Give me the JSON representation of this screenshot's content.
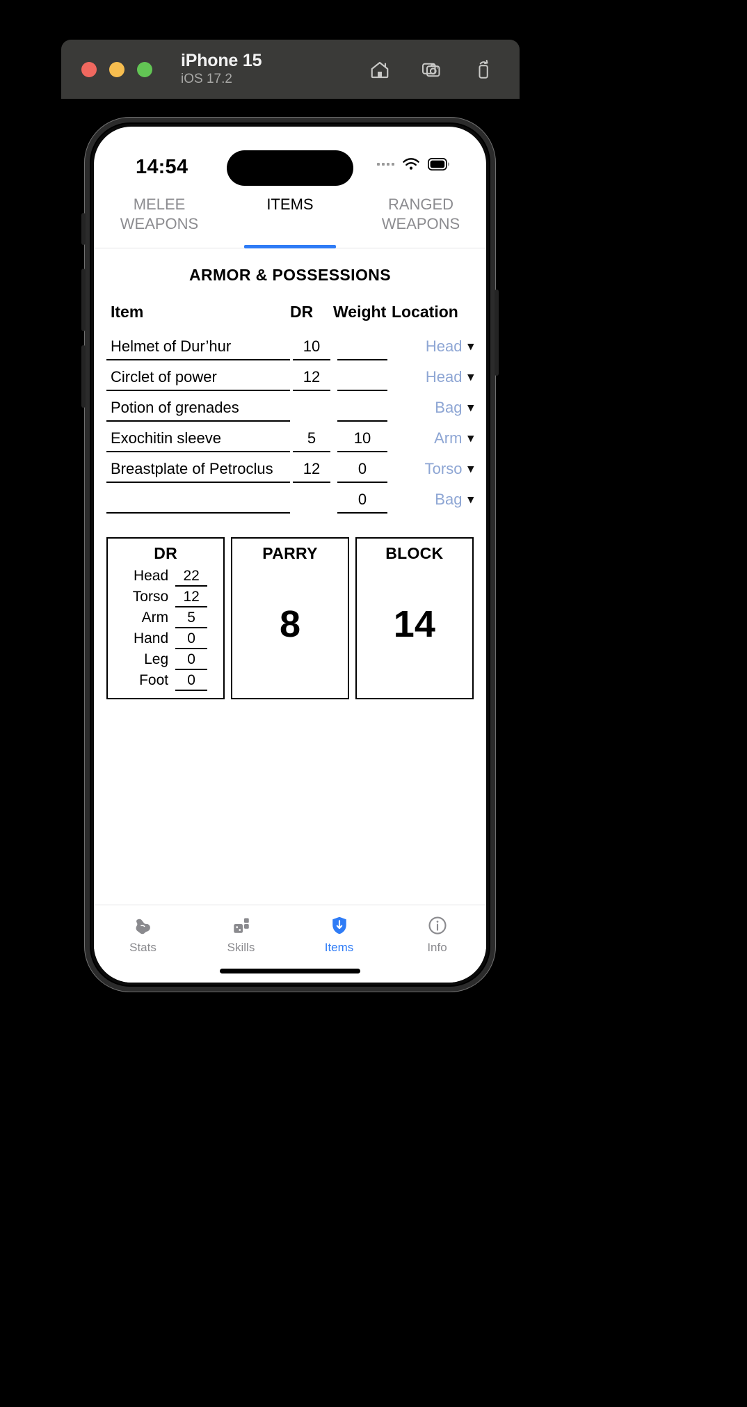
{
  "simulator": {
    "device_title": "iPhone 15",
    "os_version": "iOS 17.2",
    "window_controls": [
      "close",
      "minimize",
      "zoom"
    ],
    "actions": [
      {
        "name": "home-icon",
        "label": "Home"
      },
      {
        "name": "screenshot-icon",
        "label": "Screenshot"
      },
      {
        "name": "rotate-device-icon",
        "label": "Rotate"
      }
    ]
  },
  "status_bar": {
    "time": "14:54",
    "wifi": "wifi-icon",
    "battery": "battery-icon",
    "cellular": "signal-dots-icon"
  },
  "top_tabs": [
    {
      "label": "MELEE\nWEAPONS",
      "line1": "MELEE",
      "line2": "WEAPONS",
      "active": false
    },
    {
      "label": "ITEMS",
      "line1": "ITEMS",
      "line2": "",
      "active": true
    },
    {
      "label": "RANGED\nWEAPONS",
      "line1": "RANGED",
      "line2": "WEAPONS",
      "active": false
    }
  ],
  "section": {
    "title": "ARMOR & POSSESSIONS",
    "columns": {
      "item": "Item",
      "dr": "DR",
      "weight": "Weight",
      "location": "Location"
    },
    "rows": [
      {
        "item": "Helmet of Dur’hur",
        "dr": "10",
        "weight": "",
        "location": "Head"
      },
      {
        "item": "Circlet of power",
        "dr": "12",
        "weight": "",
        "location": "Head"
      },
      {
        "item": "Potion of grenades",
        "dr": "",
        "weight": "",
        "location": "Bag"
      },
      {
        "item": "Exochitin sleeve",
        "dr": "5",
        "weight": "10",
        "location": "Arm"
      },
      {
        "item": "Breastplate of Petroclus",
        "dr": "12",
        "weight": "0",
        "location": "Torso"
      },
      {
        "item": "",
        "dr": "",
        "weight": "0",
        "location": "Bag"
      }
    ]
  },
  "stats": {
    "dr": {
      "caption": "DR",
      "entries": [
        {
          "label": "Head",
          "value": "22"
        },
        {
          "label": "Torso",
          "value": "12"
        },
        {
          "label": "Arm",
          "value": "5"
        },
        {
          "label": "Hand",
          "value": "0"
        },
        {
          "label": "Leg",
          "value": "0"
        },
        {
          "label": "Foot",
          "value": "0"
        }
      ]
    },
    "parry": {
      "caption": "PARRY",
      "value": "8"
    },
    "block": {
      "caption": "BLOCK",
      "value": "14"
    }
  },
  "bottom_tabs": [
    {
      "label": "Stats",
      "icon": "muscle-icon",
      "active": false
    },
    {
      "label": "Skills",
      "icon": "skills-icon",
      "active": false
    },
    {
      "label": "Items",
      "icon": "shield-icon",
      "active": true
    },
    {
      "label": "Info",
      "icon": "info-icon",
      "active": false
    }
  ],
  "colors": {
    "accent": "#2f7cf6",
    "location_text": "#8ea6d4",
    "inactive_tab": "#8c8c90",
    "chrome": "#3a3a38"
  }
}
